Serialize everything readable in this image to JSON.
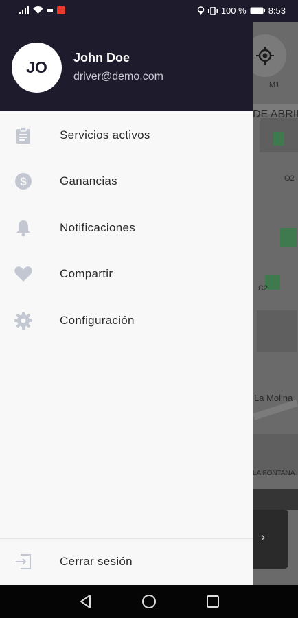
{
  "status_bar": {
    "battery_text": "100 %",
    "time": "8:53"
  },
  "map": {
    "street_labels": [
      "M1",
      "DE ABRIL",
      "O2",
      "C2",
      "La Molina",
      "LA FONTANA"
    ]
  },
  "user": {
    "initials": "JO",
    "name": "John Doe",
    "email": "driver@demo.com"
  },
  "menu": {
    "items": [
      {
        "label": "Servicios activos",
        "icon": "clipboard-icon"
      },
      {
        "label": "Ganancias",
        "icon": "dollar-icon"
      },
      {
        "label": "Notificaciones",
        "icon": "bell-icon"
      },
      {
        "label": "Compartir",
        "icon": "heart-icon"
      },
      {
        "label": "Configuración",
        "icon": "gear-icon"
      }
    ],
    "logout_label": "Cerrar sesión"
  },
  "colors": {
    "header_bg": "#1d1b2c",
    "drawer_bg": "#f8f8f8",
    "icon_color": "#c3c7d2"
  }
}
